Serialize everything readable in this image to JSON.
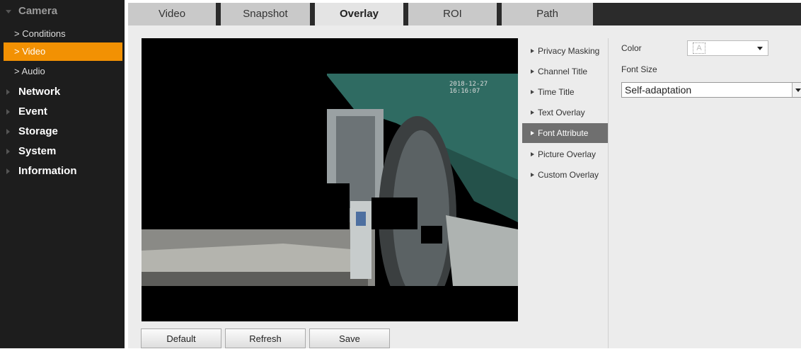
{
  "sidebar": {
    "camera": "Camera",
    "subitems": [
      {
        "label": "> Conditions"
      },
      {
        "label": "> Video"
      },
      {
        "label": "> Audio"
      }
    ],
    "categories": [
      {
        "label": "Network"
      },
      {
        "label": "Event"
      },
      {
        "label": "Storage"
      },
      {
        "label": "System"
      },
      {
        "label": "Information"
      }
    ]
  },
  "tabs": [
    {
      "label": "Video"
    },
    {
      "label": "Snapshot"
    },
    {
      "label": "Overlay"
    },
    {
      "label": "ROI"
    },
    {
      "label": "Path"
    }
  ],
  "active_tab": "Overlay",
  "video": {
    "timestamp": "2018-12-27 16:16:07"
  },
  "overlay_menu": [
    {
      "label": "Privacy Masking"
    },
    {
      "label": "Channel Title"
    },
    {
      "label": "Time Title"
    },
    {
      "label": "Text Overlay"
    },
    {
      "label": "Font Attribute"
    },
    {
      "label": "Picture Overlay"
    },
    {
      "label": "Custom Overlay"
    }
  ],
  "active_menu": "Font Attribute",
  "font_attribute": {
    "color_label": "Color",
    "color_value": "A",
    "font_size_label": "Font Size",
    "font_size_value": "Self-adaptation"
  },
  "buttons": {
    "default": "Default",
    "refresh": "Refresh",
    "save": "Save"
  },
  "colors": {
    "accent": "#f29103",
    "sidebar_bg": "#1d1d1d",
    "active_menu_bg": "#6f6f6f"
  }
}
